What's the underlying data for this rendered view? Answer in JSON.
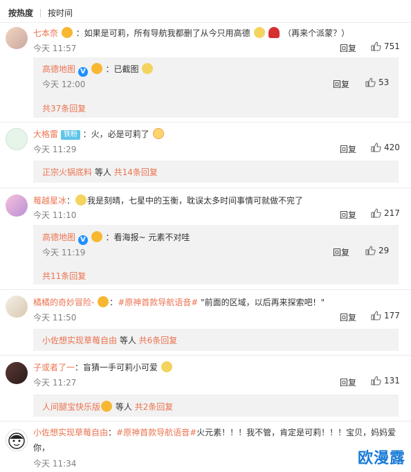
{
  "tabs": [
    "按热度",
    "按时间"
  ],
  "reply_label": "回复",
  "comments": [
    {
      "user": "七本奈",
      "text": "：如果是可莉，所有导航我都删了从今只用高德",
      "text_tail": "（再来个派蒙？）",
      "time": "今天 11:57",
      "likes": "751",
      "sub": {
        "user": "高德地图",
        "text": "：已截图",
        "time": "今天 12:00",
        "likes": "53"
      },
      "more": "共37条回复"
    },
    {
      "user": "大格雷",
      "badge": "铁粉",
      "text": "：火，必是可莉了",
      "time": "今天 11:29",
      "likes": "420",
      "more_user": "正宗火锅底料",
      "more_mid": " 等人 ",
      "more": "共14条回复"
    },
    {
      "user": "莓越星冰",
      "text": "：",
      "text_tail": "我是刻晴，七星中的玉衡，耽误太多时间事情可就做不完了",
      "time": "今天 11:10",
      "likes": "217",
      "sub": {
        "user": "高德地图",
        "text": "：看海报~ 元素不对哇",
        "time": "今天 11:19",
        "likes": "29"
      },
      "more": "共11条回复"
    },
    {
      "user": "橘橘的奇妙冒险-",
      "topic": "#原神首款导航语音#",
      "text": " \"前面的区域，以后再来探索吧！\"",
      "time": "今天 11:50",
      "likes": "177",
      "more_user": "小佐想实现草莓自由",
      "more_mid": " 等人 ",
      "more": "共6条回复"
    },
    {
      "user": "子或者了一",
      "text": "：盲猜一手可莉小可爱",
      "time": "今天 11:27",
      "likes": "131",
      "more_user": "人间腿宝快乐版",
      "more_mid": " 等人 ",
      "more": "共2条回复"
    },
    {
      "user": "小佐想实现草莓自由",
      "topic": "#原神首款导航语音#",
      "text": "火元素！！！我不管，肯定是可莉！！！宝贝，妈妈爱",
      "text_line2": "你，",
      "time": "今天 11:34"
    }
  ],
  "watermark": "欧漫露",
  "colors": {
    "accent": "#eb7350",
    "meta": "#808080",
    "subbox": "#f2f2f2"
  },
  "icons": [
    "thumb-up-icon",
    "v-verified-icon",
    "lock-emoji-icon",
    "cat-emoji-icon",
    "rose-emoji-icon",
    "kiss-emoji-icon"
  ]
}
